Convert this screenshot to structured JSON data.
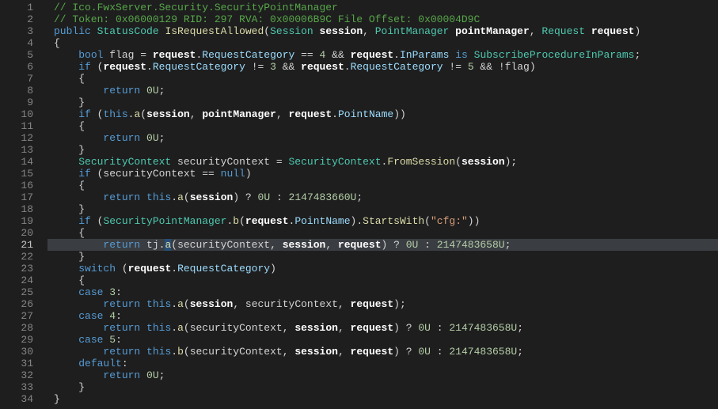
{
  "gutter": {
    "start": 1,
    "end": 34,
    "activeLine": 21
  },
  "code": {
    "lines": [
      {
        "indent": 0,
        "tokens": [
          {
            "t": "// Ico.FwxServer.Security.SecurityPointManager",
            "c": "c-comment"
          }
        ]
      },
      {
        "indent": 0,
        "tokens": [
          {
            "t": "// Token: 0x06000129 RID: 297 RVA: 0x00006B9C File Offset: 0x00004D9C",
            "c": "c-comment"
          }
        ]
      },
      {
        "indent": 0,
        "tokens": [
          {
            "t": "public",
            "c": "c-keyword"
          },
          {
            "t": " ",
            "c": "c-punc"
          },
          {
            "t": "StatusCode",
            "c": "c-type"
          },
          {
            "t": " ",
            "c": "c-punc"
          },
          {
            "t": "IsRequestAllowed",
            "c": "c-method"
          },
          {
            "t": "(",
            "c": "c-punc"
          },
          {
            "t": "Session",
            "c": "c-type"
          },
          {
            "t": " ",
            "c": "c-punc"
          },
          {
            "t": "session",
            "c": "c-param"
          },
          {
            "t": ", ",
            "c": "c-punc"
          },
          {
            "t": "PointManager",
            "c": "c-type"
          },
          {
            "t": " ",
            "c": "c-punc"
          },
          {
            "t": "pointManager",
            "c": "c-param"
          },
          {
            "t": ", ",
            "c": "c-punc"
          },
          {
            "t": "Request",
            "c": "c-type"
          },
          {
            "t": " ",
            "c": "c-punc"
          },
          {
            "t": "request",
            "c": "c-param"
          },
          {
            "t": ")",
            "c": "c-punc"
          }
        ]
      },
      {
        "indent": 0,
        "tokens": [
          {
            "t": "{",
            "c": "c-punc"
          }
        ]
      },
      {
        "indent": 1,
        "tokens": [
          {
            "t": "bool",
            "c": "c-keyword"
          },
          {
            "t": " flag = ",
            "c": "c-punc"
          },
          {
            "t": "request",
            "c": "c-param"
          },
          {
            "t": ".",
            "c": "c-punc"
          },
          {
            "t": "RequestCategory",
            "c": "c-prop"
          },
          {
            "t": " == ",
            "c": "c-punc"
          },
          {
            "t": "4",
            "c": "c-num"
          },
          {
            "t": " && ",
            "c": "c-punc"
          },
          {
            "t": "request",
            "c": "c-param"
          },
          {
            "t": ".",
            "c": "c-punc"
          },
          {
            "t": "InParams",
            "c": "c-prop"
          },
          {
            "t": " ",
            "c": "c-punc"
          },
          {
            "t": "is",
            "c": "c-keyword"
          },
          {
            "t": " ",
            "c": "c-punc"
          },
          {
            "t": "SubscribeProcedureInParams",
            "c": "c-type"
          },
          {
            "t": ";",
            "c": "c-punc"
          }
        ]
      },
      {
        "indent": 1,
        "tokens": [
          {
            "t": "if",
            "c": "c-keyword"
          },
          {
            "t": " (",
            "c": "c-punc"
          },
          {
            "t": "request",
            "c": "c-param"
          },
          {
            "t": ".",
            "c": "c-punc"
          },
          {
            "t": "RequestCategory",
            "c": "c-prop"
          },
          {
            "t": " != ",
            "c": "c-punc"
          },
          {
            "t": "3",
            "c": "c-num"
          },
          {
            "t": " && ",
            "c": "c-punc"
          },
          {
            "t": "request",
            "c": "c-param"
          },
          {
            "t": ".",
            "c": "c-punc"
          },
          {
            "t": "RequestCategory",
            "c": "c-prop"
          },
          {
            "t": " != ",
            "c": "c-punc"
          },
          {
            "t": "5",
            "c": "c-num"
          },
          {
            "t": " && !flag)",
            "c": "c-punc"
          }
        ]
      },
      {
        "indent": 1,
        "tokens": [
          {
            "t": "{",
            "c": "c-punc"
          }
        ]
      },
      {
        "indent": 2,
        "tokens": [
          {
            "t": "return",
            "c": "c-keyword"
          },
          {
            "t": " ",
            "c": "c-punc"
          },
          {
            "t": "0U",
            "c": "c-num"
          },
          {
            "t": ";",
            "c": "c-punc"
          }
        ]
      },
      {
        "indent": 1,
        "tokens": [
          {
            "t": "}",
            "c": "c-punc"
          }
        ]
      },
      {
        "indent": 1,
        "tokens": [
          {
            "t": "if",
            "c": "c-keyword"
          },
          {
            "t": " (",
            "c": "c-punc"
          },
          {
            "t": "this",
            "c": "c-keyword"
          },
          {
            "t": ".",
            "c": "c-punc"
          },
          {
            "t": "a",
            "c": "c-method"
          },
          {
            "t": "(",
            "c": "c-punc"
          },
          {
            "t": "session",
            "c": "c-param"
          },
          {
            "t": ", ",
            "c": "c-punc"
          },
          {
            "t": "pointManager",
            "c": "c-param"
          },
          {
            "t": ", ",
            "c": "c-punc"
          },
          {
            "t": "request",
            "c": "c-param"
          },
          {
            "t": ".",
            "c": "c-punc"
          },
          {
            "t": "PointName",
            "c": "c-prop"
          },
          {
            "t": "))",
            "c": "c-punc"
          }
        ]
      },
      {
        "indent": 1,
        "tokens": [
          {
            "t": "{",
            "c": "c-punc"
          }
        ]
      },
      {
        "indent": 2,
        "tokens": [
          {
            "t": "return",
            "c": "c-keyword"
          },
          {
            "t": " ",
            "c": "c-punc"
          },
          {
            "t": "0U",
            "c": "c-num"
          },
          {
            "t": ";",
            "c": "c-punc"
          }
        ]
      },
      {
        "indent": 1,
        "tokens": [
          {
            "t": "}",
            "c": "c-punc"
          }
        ]
      },
      {
        "indent": 1,
        "tokens": [
          {
            "t": "SecurityContext",
            "c": "c-type"
          },
          {
            "t": " securityContext = ",
            "c": "c-punc"
          },
          {
            "t": "SecurityContext",
            "c": "c-type"
          },
          {
            "t": ".",
            "c": "c-punc"
          },
          {
            "t": "FromSession",
            "c": "c-method"
          },
          {
            "t": "(",
            "c": "c-punc"
          },
          {
            "t": "session",
            "c": "c-param"
          },
          {
            "t": ");",
            "c": "c-punc"
          }
        ]
      },
      {
        "indent": 1,
        "tokens": [
          {
            "t": "if",
            "c": "c-keyword"
          },
          {
            "t": " (securityContext == ",
            "c": "c-punc"
          },
          {
            "t": "null",
            "c": "c-keyword"
          },
          {
            "t": ")",
            "c": "c-punc"
          }
        ]
      },
      {
        "indent": 1,
        "tokens": [
          {
            "t": "{",
            "c": "c-punc"
          }
        ]
      },
      {
        "indent": 2,
        "tokens": [
          {
            "t": "return",
            "c": "c-keyword"
          },
          {
            "t": " ",
            "c": "c-punc"
          },
          {
            "t": "this",
            "c": "c-keyword"
          },
          {
            "t": ".",
            "c": "c-punc"
          },
          {
            "t": "a",
            "c": "c-method"
          },
          {
            "t": "(",
            "c": "c-punc"
          },
          {
            "t": "session",
            "c": "c-param"
          },
          {
            "t": ") ? ",
            "c": "c-punc"
          },
          {
            "t": "0U",
            "c": "c-num"
          },
          {
            "t": " : ",
            "c": "c-punc"
          },
          {
            "t": "2147483660U",
            "c": "c-num"
          },
          {
            "t": ";",
            "c": "c-punc"
          }
        ]
      },
      {
        "indent": 1,
        "tokens": [
          {
            "t": "}",
            "c": "c-punc"
          }
        ]
      },
      {
        "indent": 1,
        "tokens": [
          {
            "t": "if",
            "c": "c-keyword"
          },
          {
            "t": " (",
            "c": "c-punc"
          },
          {
            "t": "SecurityPointManager",
            "c": "c-type"
          },
          {
            "t": ".",
            "c": "c-punc"
          },
          {
            "t": "b",
            "c": "c-method"
          },
          {
            "t": "(",
            "c": "c-punc"
          },
          {
            "t": "request",
            "c": "c-param"
          },
          {
            "t": ".",
            "c": "c-punc"
          },
          {
            "t": "PointName",
            "c": "c-prop"
          },
          {
            "t": ").",
            "c": "c-punc"
          },
          {
            "t": "StartsWith",
            "c": "c-method"
          },
          {
            "t": "(",
            "c": "c-punc"
          },
          {
            "t": "\"cfg:\"",
            "c": "c-string"
          },
          {
            "t": "))",
            "c": "c-punc"
          }
        ]
      },
      {
        "indent": 1,
        "tokens": [
          {
            "t": "{",
            "c": "c-punc"
          }
        ]
      },
      {
        "hl": true,
        "indent": 2,
        "tokens": [
          {
            "t": "return",
            "c": "c-keyword"
          },
          {
            "t": " tj.",
            "c": "c-punc"
          },
          {
            "t": "a",
            "c": "c-method",
            "sel": true
          },
          {
            "t": "(securityContext, ",
            "c": "c-punc"
          },
          {
            "t": "session",
            "c": "c-param"
          },
          {
            "t": ", ",
            "c": "c-punc"
          },
          {
            "t": "request",
            "c": "c-param"
          },
          {
            "t": ") ? ",
            "c": "c-punc"
          },
          {
            "t": "0U",
            "c": "c-num"
          },
          {
            "t": " : ",
            "c": "c-punc"
          },
          {
            "t": "2147483658U",
            "c": "c-num"
          },
          {
            "t": ";",
            "c": "c-punc"
          }
        ]
      },
      {
        "indent": 1,
        "tokens": [
          {
            "t": "}",
            "c": "c-punc"
          }
        ]
      },
      {
        "indent": 1,
        "tokens": [
          {
            "t": "switch",
            "c": "c-keyword"
          },
          {
            "t": " (",
            "c": "c-punc"
          },
          {
            "t": "request",
            "c": "c-param"
          },
          {
            "t": ".",
            "c": "c-punc"
          },
          {
            "t": "RequestCategory",
            "c": "c-prop"
          },
          {
            "t": ")",
            "c": "c-punc"
          }
        ]
      },
      {
        "indent": 1,
        "tokens": [
          {
            "t": "{",
            "c": "c-punc"
          }
        ]
      },
      {
        "indent": 1,
        "tokens": [
          {
            "t": "case",
            "c": "c-keyword"
          },
          {
            "t": " ",
            "c": "c-punc"
          },
          {
            "t": "3",
            "c": "c-num"
          },
          {
            "t": ":",
            "c": "c-punc"
          }
        ]
      },
      {
        "indent": 2,
        "tokens": [
          {
            "t": "return",
            "c": "c-keyword"
          },
          {
            "t": " ",
            "c": "c-punc"
          },
          {
            "t": "this",
            "c": "c-keyword"
          },
          {
            "t": ".",
            "c": "c-punc"
          },
          {
            "t": "a",
            "c": "c-method"
          },
          {
            "t": "(",
            "c": "c-punc"
          },
          {
            "t": "session",
            "c": "c-param"
          },
          {
            "t": ", securityContext, ",
            "c": "c-punc"
          },
          {
            "t": "request",
            "c": "c-param"
          },
          {
            "t": ");",
            "c": "c-punc"
          }
        ]
      },
      {
        "indent": 1,
        "tokens": [
          {
            "t": "case",
            "c": "c-keyword"
          },
          {
            "t": " ",
            "c": "c-punc"
          },
          {
            "t": "4",
            "c": "c-num"
          },
          {
            "t": ":",
            "c": "c-punc"
          }
        ]
      },
      {
        "indent": 2,
        "tokens": [
          {
            "t": "return",
            "c": "c-keyword"
          },
          {
            "t": " ",
            "c": "c-punc"
          },
          {
            "t": "this",
            "c": "c-keyword"
          },
          {
            "t": ".",
            "c": "c-punc"
          },
          {
            "t": "a",
            "c": "c-method"
          },
          {
            "t": "(securityContext, ",
            "c": "c-punc"
          },
          {
            "t": "session",
            "c": "c-param"
          },
          {
            "t": ", ",
            "c": "c-punc"
          },
          {
            "t": "request",
            "c": "c-param"
          },
          {
            "t": ") ? ",
            "c": "c-punc"
          },
          {
            "t": "0U",
            "c": "c-num"
          },
          {
            "t": " : ",
            "c": "c-punc"
          },
          {
            "t": "2147483658U",
            "c": "c-num"
          },
          {
            "t": ";",
            "c": "c-punc"
          }
        ]
      },
      {
        "indent": 1,
        "tokens": [
          {
            "t": "case",
            "c": "c-keyword"
          },
          {
            "t": " ",
            "c": "c-punc"
          },
          {
            "t": "5",
            "c": "c-num"
          },
          {
            "t": ":",
            "c": "c-punc"
          }
        ]
      },
      {
        "indent": 2,
        "tokens": [
          {
            "t": "return",
            "c": "c-keyword"
          },
          {
            "t": " ",
            "c": "c-punc"
          },
          {
            "t": "this",
            "c": "c-keyword"
          },
          {
            "t": ".",
            "c": "c-punc"
          },
          {
            "t": "b",
            "c": "c-method"
          },
          {
            "t": "(securityContext, ",
            "c": "c-punc"
          },
          {
            "t": "session",
            "c": "c-param"
          },
          {
            "t": ", ",
            "c": "c-punc"
          },
          {
            "t": "request",
            "c": "c-param"
          },
          {
            "t": ") ? ",
            "c": "c-punc"
          },
          {
            "t": "0U",
            "c": "c-num"
          },
          {
            "t": " : ",
            "c": "c-punc"
          },
          {
            "t": "2147483658U",
            "c": "c-num"
          },
          {
            "t": ";",
            "c": "c-punc"
          }
        ]
      },
      {
        "indent": 1,
        "tokens": [
          {
            "t": "default",
            "c": "c-keyword"
          },
          {
            "t": ":",
            "c": "c-punc"
          }
        ]
      },
      {
        "indent": 2,
        "tokens": [
          {
            "t": "return",
            "c": "c-keyword"
          },
          {
            "t": " ",
            "c": "c-punc"
          },
          {
            "t": "0U",
            "c": "c-num"
          },
          {
            "t": ";",
            "c": "c-punc"
          }
        ]
      },
      {
        "indent": 1,
        "tokens": [
          {
            "t": "}",
            "c": "c-punc"
          }
        ]
      },
      {
        "indent": 0,
        "tokens": [
          {
            "t": "}",
            "c": "c-punc"
          }
        ]
      }
    ]
  }
}
